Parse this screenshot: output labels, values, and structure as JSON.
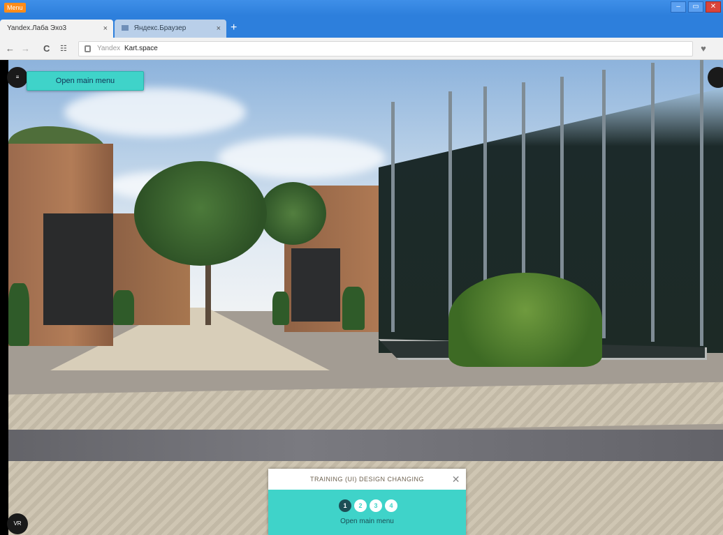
{
  "window": {
    "menu_label": "Menu",
    "controls": [
      "–",
      "▭",
      "✕"
    ]
  },
  "tabs": [
    {
      "label": "Yandex.Лаба Эхо3",
      "close": "×"
    },
    {
      "label": "Яндекс.Браузер",
      "close": "×"
    }
  ],
  "new_tab": "+",
  "nav": {
    "back": "←",
    "forward": "→",
    "reload": "C",
    "url_prefix": "Yandex",
    "url": "Kart.space",
    "heart": "♥"
  },
  "overlay": {
    "open_main_menu": "Open main menu",
    "left_top_button": "≡",
    "right_top_button": "",
    "bottom_left_button": "VR"
  },
  "training": {
    "title": "TRAINING (UI) DESIGN CHANGING",
    "close": "✕",
    "steps": [
      "1",
      "2",
      "3",
      "4"
    ],
    "active_step": 0,
    "label": "Open main menu"
  },
  "colors": {
    "accent": "#3fd3c9",
    "titlebar": "#2d7fdc",
    "menu_button": "#ff8c1a"
  }
}
